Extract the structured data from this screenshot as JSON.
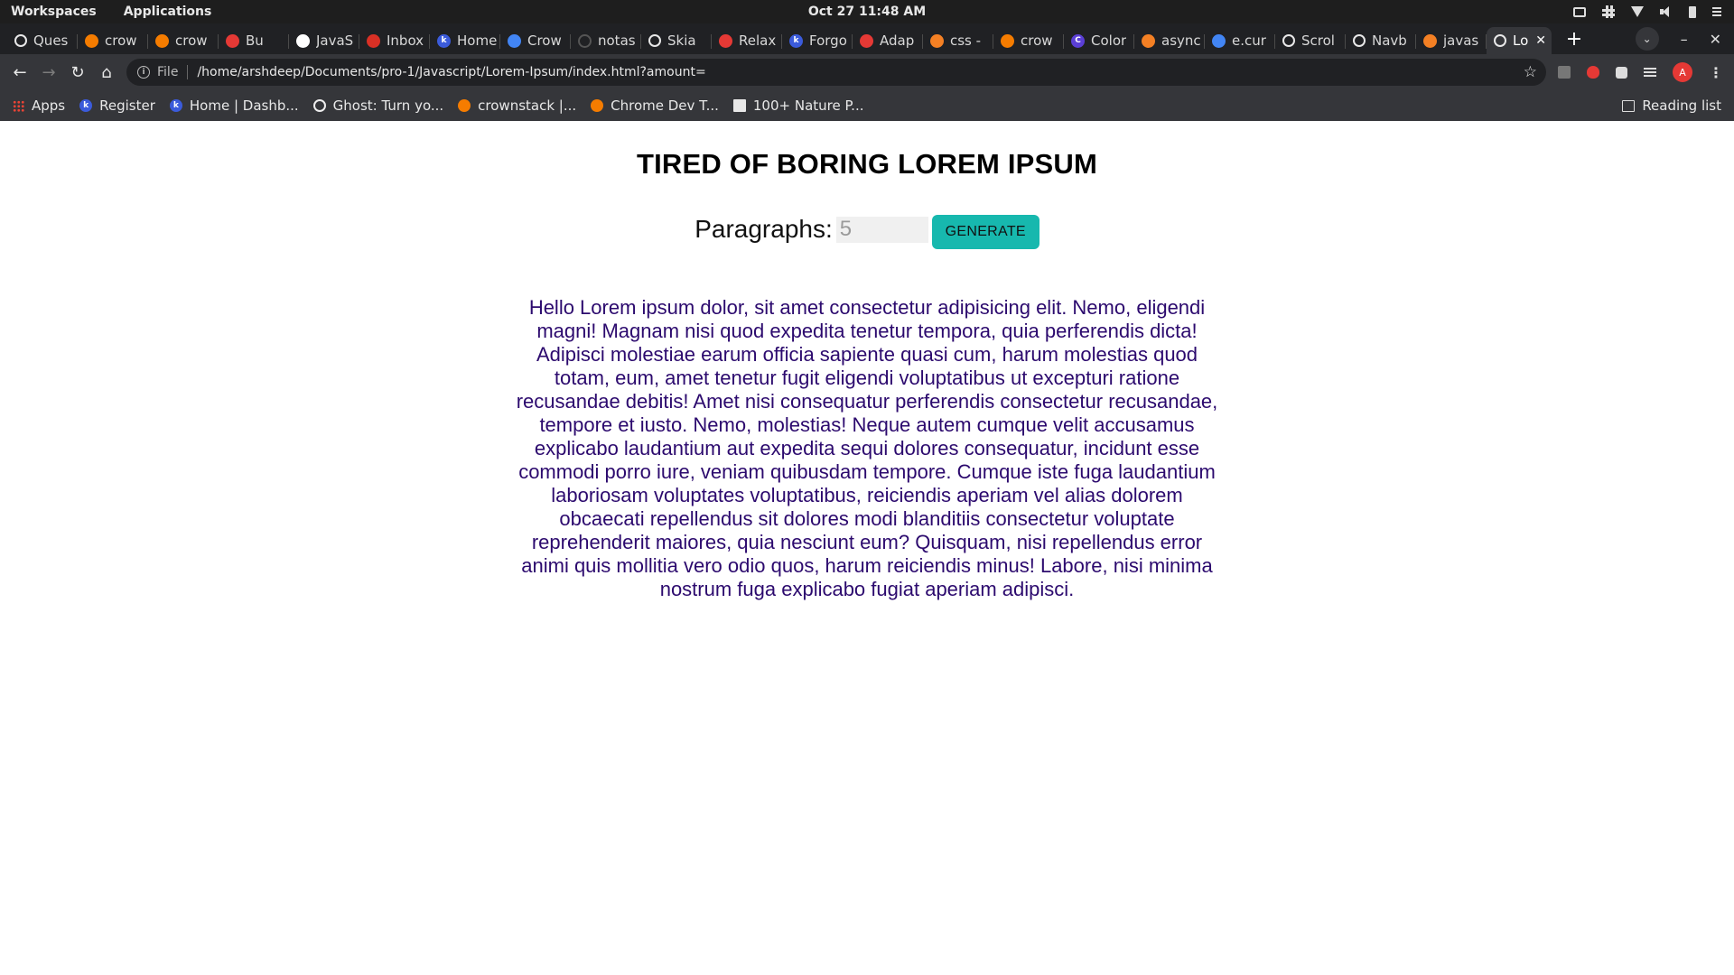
{
  "system_bar": {
    "workspaces": "Workspaces",
    "applications": "Applications",
    "datetime": "Oct 27  11:48 AM",
    "tray_icons": [
      "network-icon",
      "slack-icon",
      "wifi-icon",
      "volume-icon",
      "battery-icon",
      "menu-icon"
    ]
  },
  "tabs": [
    {
      "label": "Ques",
      "favicon": "globe",
      "color": "#ffffff"
    },
    {
      "label": "crow",
      "favicon": "crownstack",
      "color": "#f57c00"
    },
    {
      "label": "crow",
      "favicon": "crownstack",
      "color": "#f57c00"
    },
    {
      "label": "Bu",
      "favicon": "youtube",
      "color": "#e53935"
    },
    {
      "label": "JavaS",
      "favicon": "bookmark",
      "color": "#ffffff"
    },
    {
      "label": "Inbox",
      "favicon": "gmail",
      "color": "#d93025"
    },
    {
      "label": "Home",
      "favicon": "k",
      "color": "#3b5bdb"
    },
    {
      "label": "Crow",
      "favicon": "calendar",
      "color": "#4285f4"
    },
    {
      "label": "notas",
      "favicon": "loading",
      "color": "#555555"
    },
    {
      "label": "Skia",
      "favicon": "globe",
      "color": "#ffffff"
    },
    {
      "label": "Relax",
      "favicon": "youtube",
      "color": "#e53935"
    },
    {
      "label": "Forgo",
      "favicon": "k",
      "color": "#3b5bdb"
    },
    {
      "label": "Adap",
      "favicon": "asterisk",
      "color": "#e53935"
    },
    {
      "label": "css -",
      "favicon": "stackoverflow",
      "color": "#f48024"
    },
    {
      "label": "crow",
      "favicon": "crownstack",
      "color": "#f57c00"
    },
    {
      "label": "Color",
      "favicon": "c",
      "color": "#5b3fd6"
    },
    {
      "label": "async",
      "favicon": "stackoverflow",
      "color": "#f48024"
    },
    {
      "label": "e.cur",
      "favicon": "google",
      "color": "#4285f4"
    },
    {
      "label": "Scrol",
      "favicon": "globe",
      "color": "#ffffff"
    },
    {
      "label": "Navb",
      "favicon": "globe",
      "color": "#ffffff"
    },
    {
      "label": "javas",
      "favicon": "stackoverflow",
      "color": "#f48024"
    },
    {
      "label": "Lo",
      "favicon": "globe",
      "color": "#ffffff",
      "active": true
    }
  ],
  "omnibox": {
    "scheme": "File",
    "url": "/home/arshdeep/Documents/pro-1/Javascript/Lorem-Ipsum/index.html?amount="
  },
  "bookmarks": {
    "apps": "Apps",
    "items": [
      {
        "label": "Register",
        "icon": "k",
        "color": "#3b5bdb"
      },
      {
        "label": "Home | Dashb...",
        "icon": "k",
        "color": "#3b5bdb"
      },
      {
        "label": "Ghost: Turn yo...",
        "icon": "ghost",
        "color": "#222222"
      },
      {
        "label": "crownstack |...",
        "icon": "crownstack",
        "color": "#f57c00"
      },
      {
        "label": "Chrome Dev T...",
        "icon": "crownstack",
        "color": "#f57c00"
      },
      {
        "label": "100+ Nature P...",
        "icon": "unsplash",
        "color": "#111111"
      }
    ],
    "reading_list": "Reading list"
  },
  "page": {
    "title": "TIRED OF BORING LOREM IPSUM",
    "label": "Paragraphs:",
    "amount_placeholder": "5",
    "generate_button": "GENERATE",
    "paragraph": "Hello Lorem ipsum dolor, sit amet consectetur adipisicing elit. Nemo, eligendi magni! Magnam nisi quod expedita tenetur tempora, quia perferendis dicta! Adipisci molestiae earum officia sapiente quasi cum, harum molestias quod totam, eum, amet tenetur fugit eligendi voluptatibus ut excepturi ratione recusandae debitis! Amet nisi consequatur perferendis consectetur recusandae, tempore et iusto. Nemo, molestias! Neque autem cumque velit accusamus explicabo laudantium aut expedita sequi dolores consequatur, incidunt esse commodi porro iure, veniam quibusdam tempore. Cumque iste fuga laudantium laboriosam voluptates voluptatibus, reiciendis aperiam vel alias dolorem obcaecati repellendus sit dolores modi blanditiis consectetur voluptate reprehenderit maiores, quia nesciunt eum? Quisquam, nisi repellendus error animi quis mollitia vero odio quos, harum reiciendis minus! Labore, nisi minima nostrum fuga explicabo fugiat aperiam adipisci."
  },
  "colors": {
    "title": "#000000",
    "paragraph": "#2c0a6e",
    "button": "#17b8ae",
    "chrome_dark": "#202124",
    "chrome_toolbar": "#35363a"
  }
}
